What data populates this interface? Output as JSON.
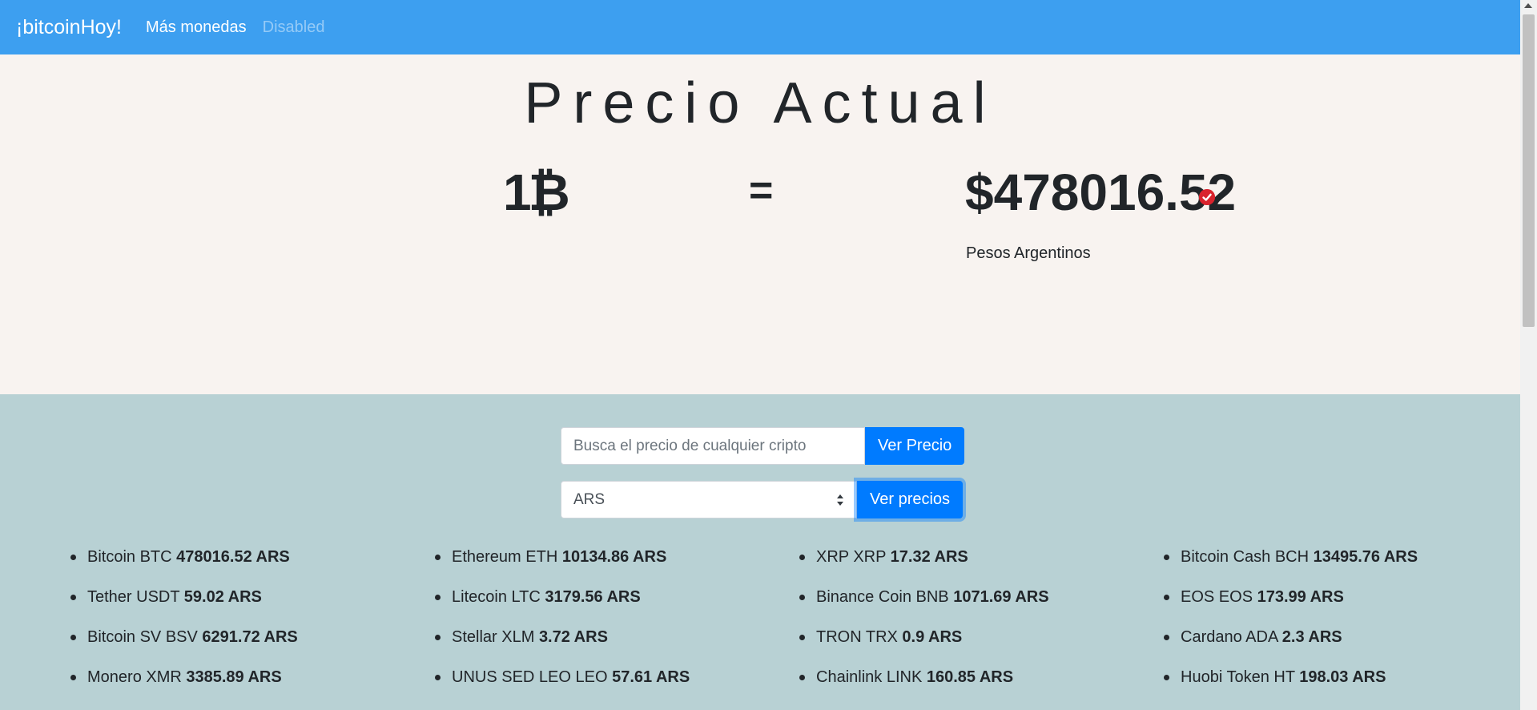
{
  "navbar": {
    "brand": "¡bitcoinHoy!",
    "links": [
      {
        "label": "Más monedas",
        "disabled": false
      },
      {
        "label": "Disabled",
        "disabled": true
      }
    ]
  },
  "hero": {
    "title": "Precio Actual",
    "btc_amount": "1₿",
    "equals": "=",
    "price": "$478016.52",
    "currency_name": "Pesos Argentinos"
  },
  "search": {
    "placeholder": "Busca el precio de cualquier cripto",
    "button_label": "Ver Precio"
  },
  "currency_select": {
    "selected": "ARS",
    "button_label": "Ver precios"
  },
  "coins": [
    {
      "name": "Bitcoin BTC",
      "price": "478016.52 ARS"
    },
    {
      "name": "Ethereum ETH",
      "price": "10134.86 ARS"
    },
    {
      "name": "XRP XRP",
      "price": "17.32 ARS"
    },
    {
      "name": "Bitcoin Cash BCH",
      "price": "13495.76 ARS"
    },
    {
      "name": "Tether USDT",
      "price": "59.02 ARS"
    },
    {
      "name": "Litecoin LTC",
      "price": "3179.56 ARS"
    },
    {
      "name": "Binance Coin BNB",
      "price": "1071.69 ARS"
    },
    {
      "name": "EOS EOS",
      "price": "173.99 ARS"
    },
    {
      "name": "Bitcoin SV BSV",
      "price": "6291.72 ARS"
    },
    {
      "name": "Stellar XLM",
      "price": "3.72 ARS"
    },
    {
      "name": "TRON TRX",
      "price": "0.9 ARS"
    },
    {
      "name": "Cardano ADA",
      "price": "2.3 ARS"
    },
    {
      "name": "Monero XMR",
      "price": "3385.89 ARS"
    },
    {
      "name": "UNUS SED LEO LEO",
      "price": "57.61 ARS"
    },
    {
      "name": "Chainlink LINK",
      "price": "160.85 ARS"
    },
    {
      "name": "Huobi Token HT",
      "price": "198.03 ARS"
    }
  ],
  "colors": {
    "navbar": "#3d9ff0",
    "hero_bg": "#f8f3f0",
    "lower_bg": "#b8d1d4",
    "primary_button": "#007bff",
    "badge": "#d9232d"
  },
  "icons": {
    "check_badge": "check-icon",
    "select_arrows": "updown-arrows-icon"
  }
}
